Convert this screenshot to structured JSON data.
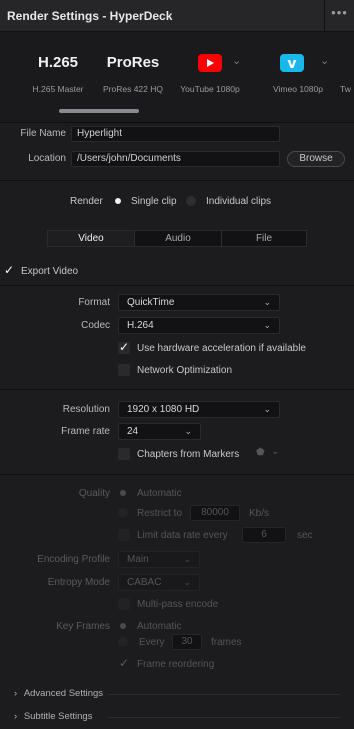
{
  "window": {
    "title": "Render Settings - HyperDeck",
    "more": "•••"
  },
  "presets": [
    {
      "name": "H.265",
      "sub": "H.265 Master",
      "logo": ""
    },
    {
      "name": "ProRes",
      "sub": "ProRes 422 HQ",
      "logo": ""
    },
    {
      "name": "",
      "sub": "YouTube 1080p",
      "logo": "youtube-logo"
    },
    {
      "name": "",
      "sub": "Vimeo 1080p",
      "logo": "vimeo-logo"
    },
    {
      "name": "",
      "sub": "Tw",
      "logo": ""
    }
  ],
  "colors": {
    "youtube": "#ff0000",
    "vimeo": "#1ab7ea",
    "background": "#1c1c1e"
  },
  "file": {
    "name_label": "File Name",
    "name_value": "Hyperlight",
    "location_label": "Location",
    "location_value": "/Users/john/Documents",
    "browse_label": "Browse"
  },
  "render": {
    "label": "Render",
    "single": "Single clip",
    "individual": "Individual clips",
    "selected": "single"
  },
  "tabs": [
    {
      "label": "Video",
      "active": true
    },
    {
      "label": "Audio",
      "active": false
    },
    {
      "label": "File",
      "active": false
    }
  ],
  "export_video": {
    "label": "Export Video",
    "checked": true
  },
  "format": {
    "label": "Format",
    "value": "QuickTime"
  },
  "codec": {
    "label": "Codec",
    "value": "H.264"
  },
  "hw_accel": {
    "label": "Use hardware acceleration if available",
    "checked": true
  },
  "network_opt": {
    "label": "Network Optimization",
    "checked": false
  },
  "resolution": {
    "label": "Resolution",
    "value": "1920 x 1080 HD"
  },
  "frame_rate": {
    "label": "Frame rate",
    "value": "24"
  },
  "chapters": {
    "label": "Chapters from Markers",
    "checked": false
  },
  "quality": {
    "label": "Quality",
    "automatic": "Automatic",
    "restrict": "Restrict to",
    "restrict_value": "80000",
    "restrict_unit": "Kb/s",
    "limit_label": "Limit data rate every",
    "limit_value": "6",
    "limit_unit": "sec"
  },
  "encoding_profile": {
    "label": "Encoding Profile",
    "value": "Main"
  },
  "entropy_mode": {
    "label": "Entropy Mode",
    "value": "CABAC"
  },
  "multipass": {
    "label": "Multi-pass encode"
  },
  "key_frames": {
    "label": "Key Frames",
    "automatic": "Automatic",
    "every": "Every",
    "every_value": "30",
    "unit": "frames"
  },
  "frame_reordering": {
    "label": "Frame reordering",
    "checked": true
  },
  "sections": [
    {
      "label": "Advanced Settings"
    },
    {
      "label": "Subtitle Settings"
    }
  ]
}
